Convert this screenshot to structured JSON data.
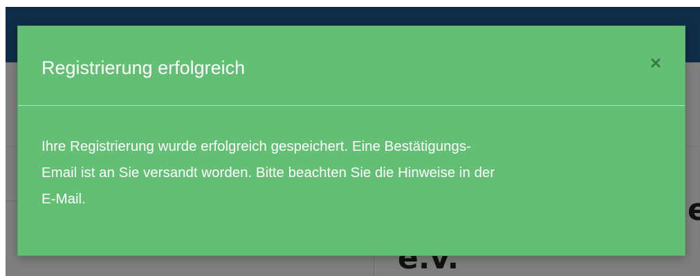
{
  "background": {
    "heading_fragment": "e.v.",
    "heading_tail": "e"
  },
  "modal": {
    "title": "Registrierung erfolgreich",
    "close_icon": "close-icon",
    "message_lines": [
      "Ihre Registrierung wurde erfolgreich gespeichert. Eine Bestätigungs-",
      "Email ist an Sie versandt worden. Bitte beachten Sie die Hinweise in der",
      "E-Mail."
    ]
  },
  "colors": {
    "modal_background": "#62bf74",
    "header_bar": "#1e5a8c",
    "text": "#ffffff"
  }
}
